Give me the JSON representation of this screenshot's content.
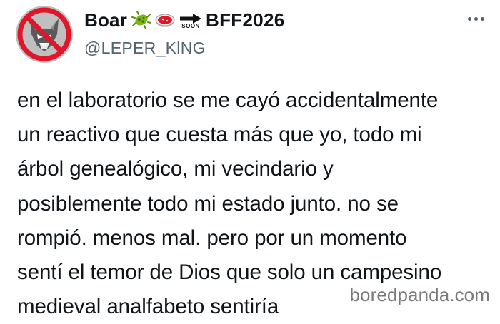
{
  "profile": {
    "display_name": "Boar",
    "soon_label": "SOON",
    "name_suffix": "BFF2026",
    "handle": "@LEPER_KlNG",
    "avatar_icon": "crossed-out-wolf-avatar",
    "emojis": [
      "microbe-icon",
      "petri-dish-icon",
      "right-arrow-icon"
    ]
  },
  "tweet": {
    "lines": [
      "en el laboratorio se me cayó accidentalmente",
      "un reactivo que cuesta más que yo, todo mi",
      "árbol genealógico, mi vecindario y",
      "posiblemente todo mi estado junto. no se",
      "rompió. menos mal.  pero por  un momento",
      "sentí el temor de Dios que solo un campesino",
      "medieval analfabeto sentiría"
    ]
  },
  "menu": {
    "more_icon": "more-options-icon"
  },
  "watermark": "boredpanda.com",
  "colors": {
    "text": "#0f1419",
    "secondary": "#536471",
    "avatar_ring": "#e0162b",
    "microbe": "#7ab51d",
    "watermark": "#7a7a7a"
  }
}
